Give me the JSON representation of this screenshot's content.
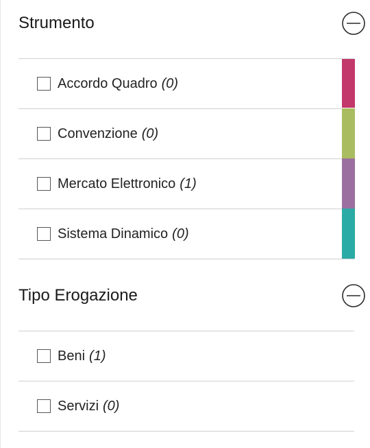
{
  "strumento": {
    "title": "Strumento",
    "options": [
      {
        "label": "Accordo Quadro",
        "count": "(0)",
        "color": "#c2386a"
      },
      {
        "label": "Convenzione",
        "count": "(0)",
        "color": "#a9bc60"
      },
      {
        "label": "Mercato Elettronico",
        "count": "(1)",
        "color": "#9b6fa0"
      },
      {
        "label": "Sistema Dinamico",
        "count": "(0)",
        "color": "#2aaba5"
      }
    ]
  },
  "tipo_erogazione": {
    "title": "Tipo Erogazione",
    "options": [
      {
        "label": "Beni",
        "count": "(1)"
      },
      {
        "label": "Servizi",
        "count": "(0)"
      }
    ]
  },
  "icons": {
    "collapse": "minus-circle-icon",
    "checkbox": "checkbox-icon"
  },
  "colors": {
    "divider": "#cfcfcf",
    "text": "#1f1f1f"
  }
}
